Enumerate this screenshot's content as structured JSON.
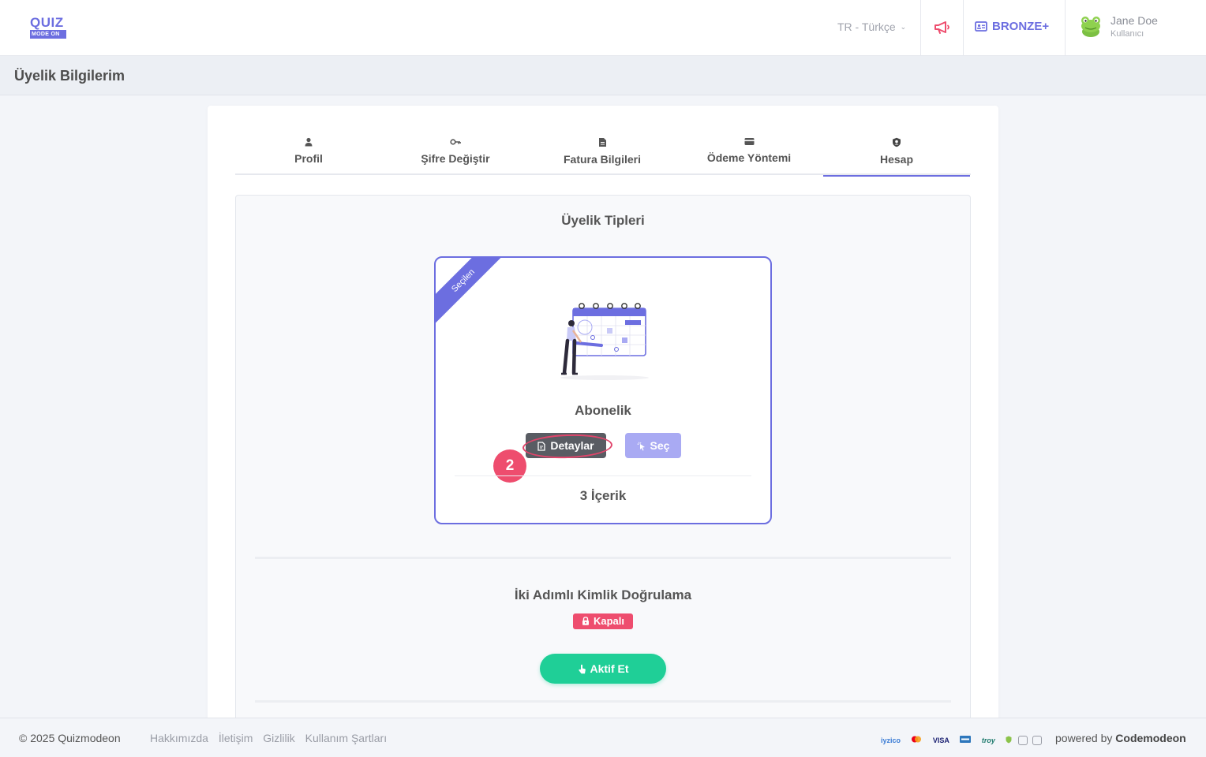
{
  "brand": {
    "logo_top": "QUIZ",
    "logo_bottom": "MODE ON",
    "accent": "#6c6ee0"
  },
  "header": {
    "language": "TR - Türkçe",
    "plan_badge": "BRONZE+",
    "user": {
      "name": "Jane Doe",
      "role": "Kullanıcı"
    },
    "icons": [
      "megaphone-icon",
      "id-card-icon",
      "frog-avatar"
    ]
  },
  "page": {
    "title": "Üyelik Bilgilerim"
  },
  "tabs": [
    {
      "label": "Profil",
      "icon": "user-icon"
    },
    {
      "label": "Şifre Değiştir",
      "icon": "key-icon"
    },
    {
      "label": "Fatura Bilgileri",
      "icon": "document-icon"
    },
    {
      "label": "Ödeme Yöntemi",
      "icon": "credit-card-icon"
    },
    {
      "label": "Hesap",
      "icon": "shield-icon",
      "active": true
    }
  ],
  "membership": {
    "title": "Üyelik Tipleri",
    "plan": {
      "ribbon": "Seçilen",
      "name": "Abonelik",
      "details_button": "Detaylar",
      "select_button": "Seç",
      "content_count": "3 İçerik"
    },
    "step_marker": "2"
  },
  "two_factor": {
    "title": "İki Adımlı Kimlik Doğrulama",
    "status": "Kapalı",
    "status_color": "#ee4d6e",
    "activate_button": "Aktif Et",
    "activate_color": "#1fcf97"
  },
  "footer": {
    "copyright": "© 2025 Quizmodeon",
    "links": [
      "Hakkımızda",
      "İletişim",
      "Gizlilik",
      "Kullanım Şartları"
    ],
    "payment_logos": [
      "iyzico",
      "mastercard",
      "VISA",
      "amex",
      "troy",
      "ssl"
    ],
    "powered_prefix": "powered by",
    "powered_brand": "Codemodeon"
  }
}
